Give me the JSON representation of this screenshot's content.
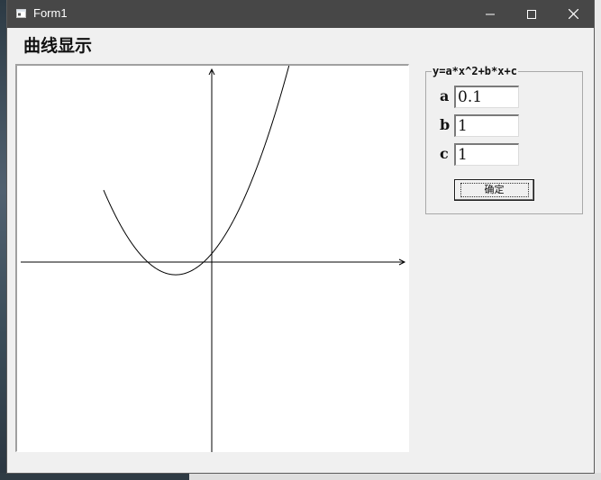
{
  "window": {
    "title": "Form1",
    "controls": {
      "minimize_icon": "minimize-icon",
      "maximize_icon": "maximize-icon",
      "close_icon": "close-icon"
    }
  },
  "heading": "曲线显示",
  "plot": {
    "equation": "y=a*x^2+b*x+c",
    "params": {
      "a": 0.1,
      "b": 1,
      "c": 1
    },
    "x_axis_arrow": true,
    "y_axis_arrow": true
  },
  "params_panel": {
    "title": "y=a*x^2+b*x+c",
    "fields": [
      {
        "label": "a",
        "value": "0.1"
      },
      {
        "label": "b",
        "value": "1"
      },
      {
        "label": "c",
        "value": "1"
      }
    ],
    "ok_label": "确定"
  },
  "colors": {
    "titlebar": "#474747",
    "face": "#f0f0f0",
    "plot_bg": "#ffffff",
    "curve": "#000000"
  }
}
